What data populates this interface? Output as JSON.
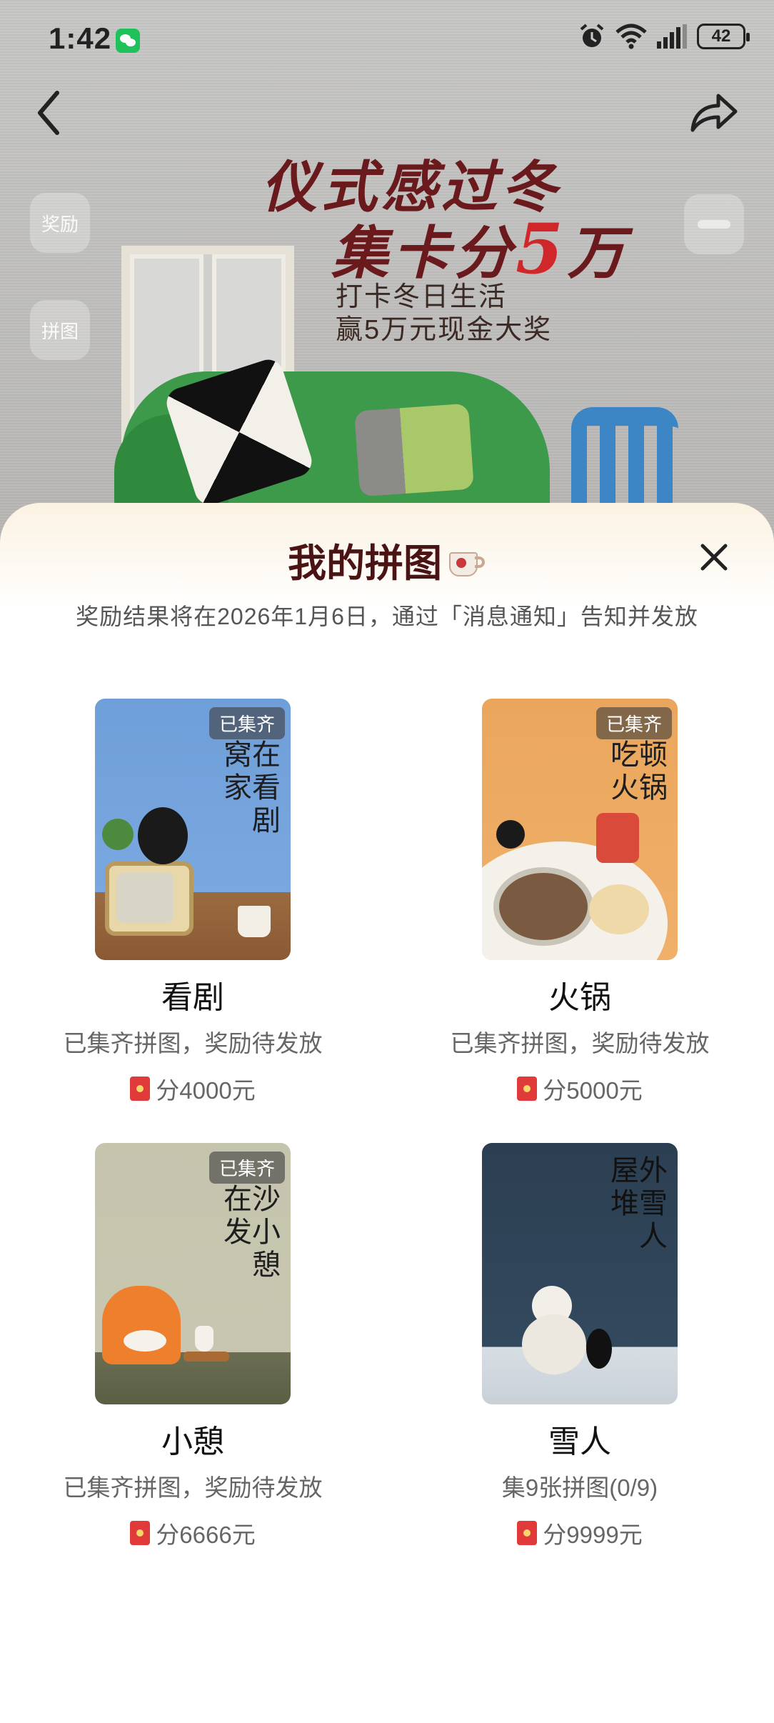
{
  "status_bar": {
    "time": "1:42",
    "battery": "42"
  },
  "hero": {
    "title_line1": "仪式感过冬",
    "title_line2_prefix": "集卡分",
    "title_line2_highlight": "5",
    "title_line2_suffix": "万",
    "subtitle_line1": "打卡冬日生活",
    "subtitle_line2": "赢5万元现金大奖",
    "side_buttons": {
      "reward": "奖励",
      "puzzle": "拼图"
    }
  },
  "sheet": {
    "title": "我的拼图",
    "note": "奖励结果将在2026年1月6日，通过「消息通知」告知并发放",
    "collected_tag": "已集齐",
    "cards": [
      {
        "name": "看剧",
        "status": "已集齐拼图，奖励待发放",
        "prize": "分4000元",
        "art_text": "窝在家看剧"
      },
      {
        "name": "火锅",
        "status": "已集齐拼图，奖励待发放",
        "prize": "分5000元",
        "art_text": "吃顿火锅"
      },
      {
        "name": "小憩",
        "status": "已集齐拼图，奖励待发放",
        "prize": "分6666元",
        "art_text": "在沙发小憩"
      },
      {
        "name": "雪人",
        "status": "集9张拼图(0/9)",
        "prize": "分9999元",
        "art_text": "屋外堆雪人"
      }
    ]
  },
  "colors": {
    "title_dark_red": "#4a1414",
    "hero_red": "#d0282a",
    "envelope_red": "#e13a3a"
  }
}
